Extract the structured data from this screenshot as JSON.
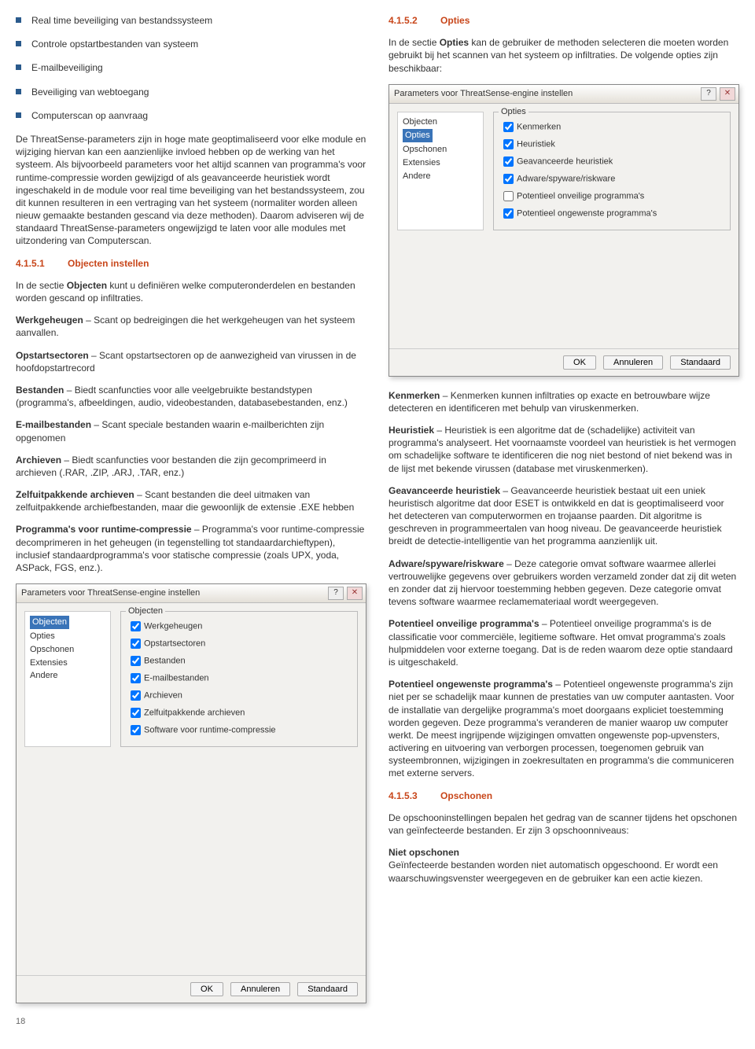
{
  "left": {
    "bullets": [
      "Real time beveiliging van bestandssysteem",
      "Controle opstartbestanden van systeem",
      "E-mailbeveiliging",
      "Beveiliging van webtoegang",
      "Computerscan op aanvraag"
    ],
    "para1": "De ThreatSense-parameters zijn in hoge mate geoptimaliseerd voor elke module en wijziging hiervan kan een aanzienlijke invloed hebben op de werking van het systeem. Als bijvoorbeeld parameters voor het altijd scannen van programma's voor runtime-compressie worden gewijzigd of als geavanceerde heuristiek wordt ingeschakeld in de module voor real time beveiliging van het bestandssysteem, zou dit kunnen resulteren in een vertraging van het systeem (normaliter worden alleen nieuw gemaakte bestanden gescand via deze methoden). Daarom adviseren wij de standaard ThreatSense-parameters ongewijzigd te laten voor alle modules met uitzondering van Computerscan.",
    "h1_num": "4.1.5.1",
    "h1_text": "Objecten instellen",
    "para2": "In de sectie Objecten kunt u definiëren welke computeronderdelen en bestanden worden gescand op infiltraties.",
    "defs": [
      {
        "term": "Werkgeheugen",
        "text": " – Scant op bedreigingen die het werkgeheugen van het systeem aanvallen."
      },
      {
        "term": "Opstartsectoren",
        "text": " – Scant opstartsectoren op de aanwezigheid van virussen in de hoofdopstartrecord"
      },
      {
        "term": "Bestanden",
        "text": " – Biedt scanfuncties voor alle veelgebruikte bestandstypen (programma's, afbeeldingen, audio, videobestanden, databasebestanden, enz.)"
      },
      {
        "term": "E-mailbestanden",
        "text": " – Scant speciale bestanden waarin e-mailberichten zijn opgenomen"
      },
      {
        "term": "Archieven",
        "text": " – Biedt scanfuncties voor bestanden die zijn gecomprimeerd in archieven (.RAR, .ZIP, .ARJ, .TAR, enz.)"
      },
      {
        "term": "Zelfuitpakkende archieven",
        "text": " – Scant bestanden die deel uitmaken van zelfuitpakkende archiefbestanden, maar die gewoonlijk de extensie .EXE hebben"
      },
      {
        "term": "Programma's voor runtime-compressie",
        "text": " – Programma's voor runtime-compressie decomprimeren in het geheugen (in tegenstelling tot standaardarchieftypen), inclusief standaardprogramma's voor statische compressie (zoals UPX, yoda, ASPack, FGS, enz.)."
      }
    ],
    "dlg": {
      "title": "Parameters voor ThreatSense-engine instellen",
      "tree": [
        "Objecten",
        "Opties",
        "Opschonen",
        "Extensies",
        "Andere"
      ],
      "selected_index": 0,
      "group": "Objecten",
      "checks": [
        {
          "label": "Werkgeheugen",
          "checked": true
        },
        {
          "label": "Opstartsectoren",
          "checked": true
        },
        {
          "label": "Bestanden",
          "checked": true
        },
        {
          "label": "E-mailbestanden",
          "checked": true
        },
        {
          "label": "Archieven",
          "checked": true
        },
        {
          "label": "Zelfuitpakkende archieven",
          "checked": true
        },
        {
          "label": "Software voor runtime-compressie",
          "checked": true
        }
      ],
      "btn_ok": "OK",
      "btn_cancel": "Annuleren",
      "btn_default": "Standaard"
    },
    "page_number": "18"
  },
  "right": {
    "h1_num": "4.1.5.2",
    "h1_text": "Opties",
    "para1": "In de sectie Opties kan de gebruiker de methoden selecteren die moeten worden gebruikt bij het scannen van het systeem op infiltraties. De volgende opties zijn beschikbaar:",
    "dlg": {
      "title": "Parameters voor ThreatSense-engine instellen",
      "tree": [
        "Objecten",
        "Opties",
        "Opschonen",
        "Extensies",
        "Andere"
      ],
      "selected_index": 1,
      "group": "Opties",
      "checks": [
        {
          "label": "Kenmerken",
          "checked": true
        },
        {
          "label": "Heuristiek",
          "checked": true
        },
        {
          "label": "Geavanceerde heuristiek",
          "checked": true
        },
        {
          "label": "Adware/spyware/riskware",
          "checked": true
        },
        {
          "label": "Potentieel onveilige programma's",
          "checked": false
        },
        {
          "label": "Potentieel ongewenste programma's",
          "checked": true
        }
      ],
      "btn_ok": "OK",
      "btn_cancel": "Annuleren",
      "btn_default": "Standaard"
    },
    "defs": [
      {
        "term": "Kenmerken",
        "text": " – Kenmerken kunnen infiltraties op exacte en betrouwbare wijze detecteren en identificeren met behulp van viruskenmerken."
      },
      {
        "term": "Heuristiek",
        "text": " – Heuristiek is een algoritme dat de (schadelijke) activiteit van programma's analyseert. Het voornaamste voordeel van heuristiek is het vermogen om schadelijke software te identificeren die nog niet bestond of niet bekend was in de lijst met bekende virussen (database met viruskenmerken)."
      },
      {
        "term": "Geavanceerde heuristiek",
        "text": " – Geavanceerde heuristiek bestaat uit een uniek heuristisch algoritme dat door ESET is ontwikkeld en dat is geoptimaliseerd voor het detecteren van computerwormen en trojaanse paarden. Dit algoritme is geschreven in programmeertalen van hoog niveau. De geavanceerde heuristiek breidt de detectie-intelligentie van het programma aanzienlijk uit."
      },
      {
        "term": "Adware/spyware/riskware",
        "text": " – Deze categorie omvat software waarmee allerlei vertrouwelijke gegevens over gebruikers worden verzameld zonder dat zij dit weten en zonder dat zij hiervoor toestemming hebben gegeven. Deze categorie omvat tevens software waarmee reclamemateriaal wordt weergegeven."
      },
      {
        "term": "Potentieel onveilige programma's",
        "text": " – Potentieel onveilige programma's is de classificatie voor commerciële, legitieme software. Het omvat programma's zoals hulpmiddelen voor externe toegang. Dat is de reden waarom deze optie standaard is uitgeschakeld."
      },
      {
        "term": "Potentieel ongewenste programma's",
        "text": " – Potentieel ongewenste programma's zijn niet per se schadelijk maar kunnen de prestaties van uw computer aantasten. Voor de installatie van dergelijke programma's moet doorgaans expliciet toestemming worden gegeven. Deze programma's veranderen de manier waarop uw computer werkt. De meest ingrijpende wijzigingen omvatten ongewenste pop-upvensters, activering en uitvoering van verborgen processen, toegenomen gebruik van systeembronnen, wijzigingen in zoekresultaten en programma's die communiceren met externe servers."
      }
    ],
    "h2_num": "4.1.5.3",
    "h2_text": "Opschonen",
    "para2": "De opschooninstellingen bepalen het gedrag van de scanner tijdens het opschonen van geïnfecteerde bestanden. Er zijn 3 opschoonniveaus:",
    "niet_term": "Niet opschonen",
    "niet_text": "Geïnfecteerde bestanden worden niet automatisch opgeschoond. Er wordt een waarschuwingsvenster weergegeven en de gebruiker kan een actie kiezen."
  }
}
